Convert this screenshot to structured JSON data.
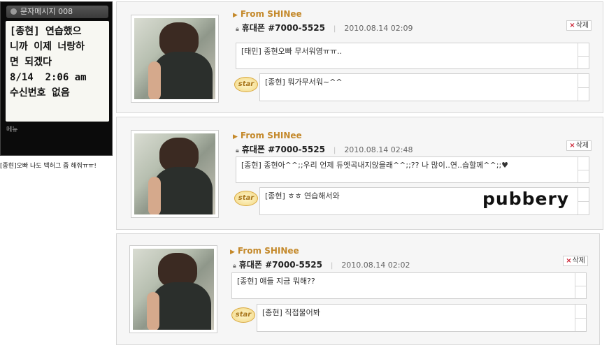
{
  "phone": {
    "title": "문자메시지 008",
    "lines": [
      "[종현] 연습했으",
      "니까 이제 너랑하",
      "면 되겠다",
      "8/14  2:06 am",
      "수신번호 없음"
    ],
    "menu": "메뉴",
    "caption": "[종현]오빠 나도 백허그 좀 해줘ㅠㅠ!"
  },
  "posts": [
    {
      "from": "From SHINee",
      "sender": "휴대폰 #7000-5525",
      "date": "2010.08.14 02:09",
      "delete": "삭제",
      "message": "[태민] 종현오빠 무서워영ㅠㅠ..",
      "star_label": "star",
      "reply": "[종현] 뭐가무서워~^^"
    },
    {
      "from": "From SHINee",
      "sender": "휴대폰 #7000-5525",
      "date": "2010.08.14 02:48",
      "delete": "삭제",
      "message": "[종현] 종현아^^;;우리 언제 듀엣곡내지않을래^^;;?? 나 많이..연..습할께^^;;♥",
      "star_label": "star",
      "reply": "[종현] ㅎㅎ 연습해서와"
    },
    {
      "from": "From SHINee",
      "sender": "휴대폰 #7000-5525",
      "date": "2010.08.14 02:02",
      "delete": "삭제",
      "message": "[종현] 얘들 지금 뭐해??",
      "star_label": "star",
      "reply": "[종현] 직접물어봐"
    }
  ],
  "watermark": "pubbery"
}
